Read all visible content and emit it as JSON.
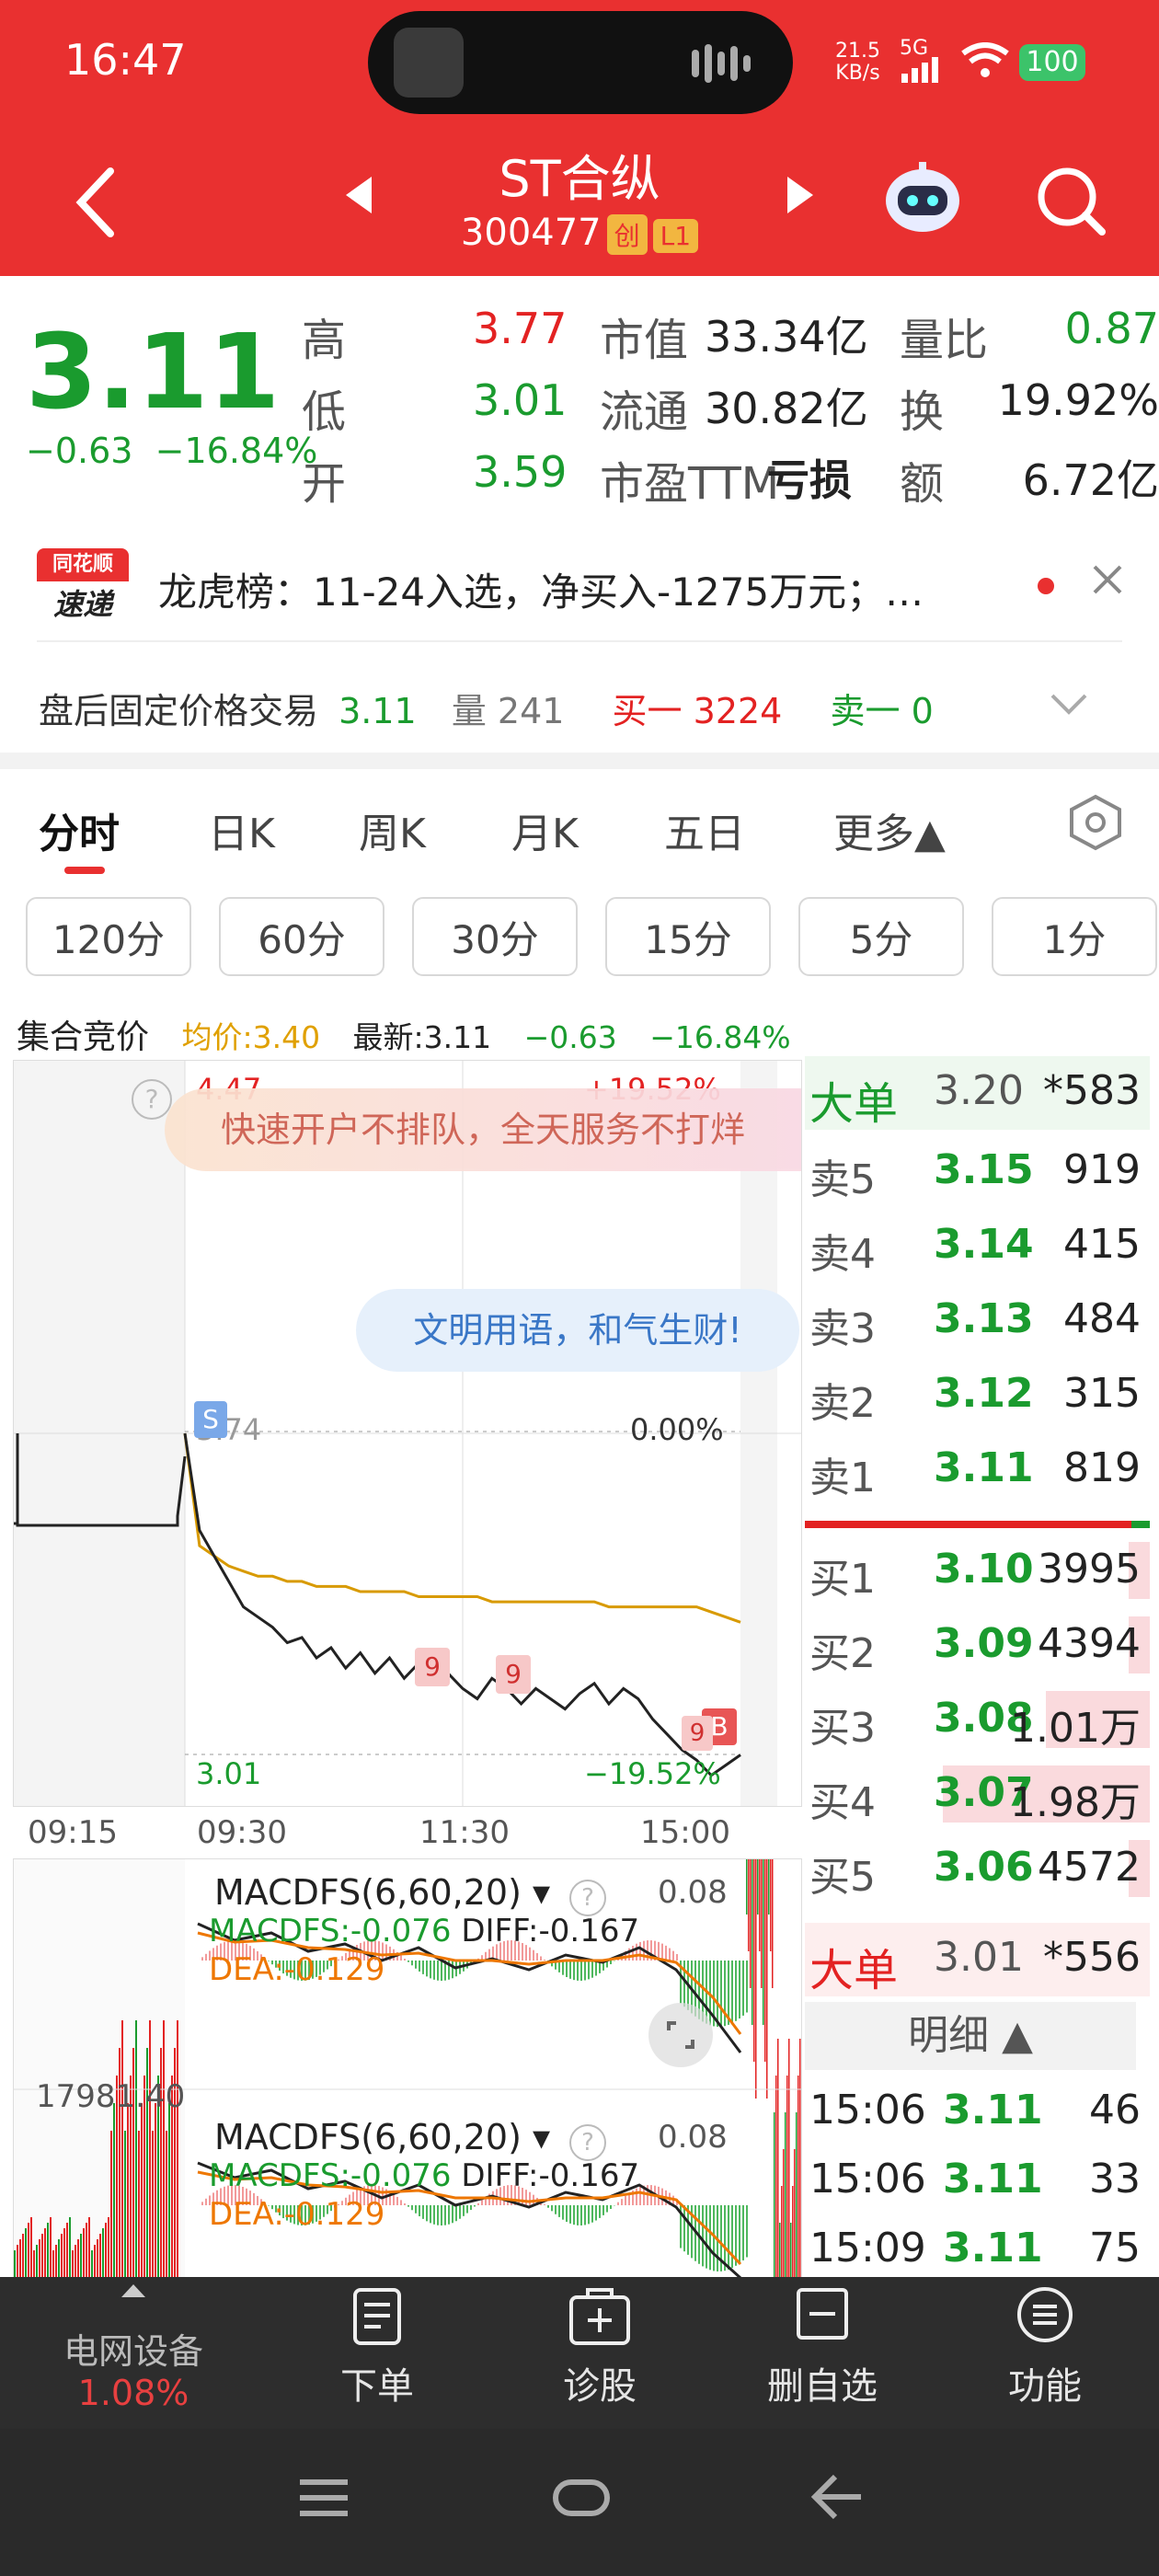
{
  "status": {
    "time": "16:47",
    "net_speed": "21.5",
    "net_unit": "KB/s",
    "net_type": "5G",
    "battery": "100"
  },
  "stock": {
    "name": "ST合纵",
    "code": "300477",
    "tag1": "创",
    "tag2": "L1"
  },
  "quote": {
    "price": "3.11",
    "change": "−0.63",
    "change_pct": "−16.84%",
    "high_label": "高",
    "high": "3.77",
    "low_label": "低",
    "low": "3.01",
    "open_label": "开",
    "open": "3.59",
    "mcap_label": "市值",
    "mcap": "33.34亿",
    "float_label": "流通",
    "float": "30.82亿",
    "pe_label": "市盈TTM",
    "pe": "亏损",
    "vr_label": "量比",
    "vr": "0.87",
    "turn_label": "换",
    "turn": "19.92%",
    "amt_label": "额",
    "amt": "6.72亿"
  },
  "news": {
    "brand_top": "同花顺",
    "brand_bottom": "速递",
    "text": "龙虎榜：11-24入选，净买入-1275万元；…"
  },
  "afterhours": {
    "label": "盘后固定价格交易",
    "price": "3.11",
    "vol_label": "量",
    "vol": "241",
    "buy_label": "买一",
    "buy": "3224",
    "sell_label": "卖一",
    "sell": "0"
  },
  "tabs": [
    "分时",
    "日K",
    "周K",
    "月K",
    "五日",
    "更多▲"
  ],
  "periods": [
    "120分",
    "60分",
    "30分",
    "15分",
    "5分",
    "1分"
  ],
  "chart_header": {
    "label": "集合竞价",
    "avg": "均价:3.40",
    "latest": "最新:3.11",
    "chg": "−0.63",
    "pct": "−16.84%"
  },
  "chart_data": {
    "type": "line",
    "x_ticks": [
      "09:15",
      "09:30",
      "11:30",
      "15:00"
    ],
    "y_top": "4.47",
    "y_top_pct": "+19.52%",
    "y_mid": "3.74",
    "y_mid_pct": "0.00%",
    "y_bot": "3.01",
    "y_bot_pct": "−19.52%",
    "ylim": [
      3.01,
      4.47
    ],
    "price_series": [
      3.74,
      3.55,
      3.5,
      3.45,
      3.4,
      3.38,
      3.36,
      3.33,
      3.34,
      3.3,
      3.32,
      3.28,
      3.31,
      3.27,
      3.3,
      3.26,
      3.29,
      3.25,
      3.27,
      3.24,
      3.22,
      3.26,
      3.24,
      3.21,
      3.24,
      3.22,
      3.2,
      3.23,
      3.25,
      3.21,
      3.24,
      3.22,
      3.18,
      3.15,
      3.12,
      3.1,
      3.07,
      3.09,
      3.11
    ],
    "avg_series": [
      3.74,
      3.52,
      3.5,
      3.48,
      3.47,
      3.46,
      3.46,
      3.45,
      3.45,
      3.44,
      3.44,
      3.44,
      3.43,
      3.43,
      3.43,
      3.43,
      3.42,
      3.42,
      3.42,
      3.42,
      3.42,
      3.41,
      3.41,
      3.41,
      3.41,
      3.41,
      3.41,
      3.41,
      3.41,
      3.4,
      3.4,
      3.4,
      3.4,
      3.4,
      3.4,
      3.4,
      3.39,
      3.38,
      3.37
    ],
    "auction_value": "17981.40"
  },
  "ads": {
    "banner": "快速开户不排队，全天服务不打烊",
    "bubble": "文明用语，和气生财!"
  },
  "macd": {
    "title": "MACDFS(6,60,20)",
    "macd": "MACDFS:-0.076",
    "diff": "DIFF:-0.167",
    "dea": "DEA:-0.129",
    "val": "0.08"
  },
  "orderbook": {
    "big_ask_label": "大单",
    "big_ask_price": "3.20",
    "big_ask_vol": "*583",
    "asks": [
      {
        "label": "卖5",
        "price": "3.15",
        "vol": "919"
      },
      {
        "label": "卖4",
        "price": "3.14",
        "vol": "415"
      },
      {
        "label": "卖3",
        "price": "3.13",
        "vol": "484"
      },
      {
        "label": "卖2",
        "price": "3.12",
        "vol": "315"
      },
      {
        "label": "卖1",
        "price": "3.11",
        "vol": "819"
      }
    ],
    "bids": [
      {
        "label": "买1",
        "price": "3.10",
        "vol": "3995",
        "fill": 0.06
      },
      {
        "label": "买2",
        "price": "3.09",
        "vol": "4394",
        "fill": 0.06
      },
      {
        "label": "买3",
        "price": "3.08",
        "vol": "1.01万",
        "fill": 0.3
      },
      {
        "label": "买4",
        "price": "3.07",
        "vol": "1.98万",
        "fill": 0.6
      },
      {
        "label": "买5",
        "price": "3.06",
        "vol": "4572",
        "fill": 0.06
      }
    ],
    "big_bid_label": "大单",
    "big_bid_price": "3.01",
    "big_bid_vol": "*556",
    "detail_label": "明细 ▲",
    "trades": [
      {
        "time": "15:06",
        "price": "3.11",
        "vol": "46"
      },
      {
        "time": "15:06",
        "price": "3.11",
        "vol": "33"
      },
      {
        "time": "15:09",
        "price": "3.11",
        "vol": "75"
      }
    ]
  },
  "bottom": {
    "sector": "电网设备",
    "sector_pct": "1.08%",
    "order": "下单",
    "diagnose": "诊股",
    "remove": "删自选",
    "func": "功能"
  }
}
